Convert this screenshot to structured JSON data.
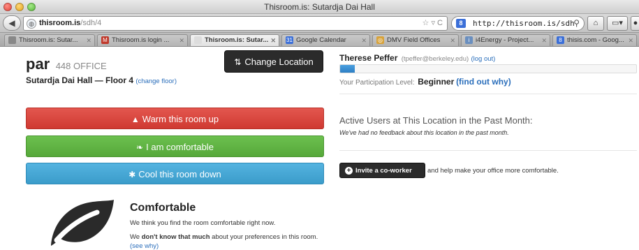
{
  "window": {
    "title": "Thisroom.is: Sutardja Dai Hall"
  },
  "nav": {
    "url_host": "thisroom.is",
    "url_path": "/sdh/4",
    "url_end_icons": "☆ ▿ C",
    "search_value": "http://thisroom.is/sdh",
    "search_engine_letter": "8"
  },
  "tabs": [
    {
      "label": "Thisroom.is: Sutar...",
      "active": false,
      "fav_color": "#888888",
      "fav": ""
    },
    {
      "label": "Thisroom.is login ...",
      "active": false,
      "fav_color": "#c0392b",
      "fav": "M"
    },
    {
      "label": "Thisroom.is: Sutar...",
      "active": true,
      "fav_color": "#dddddd",
      "fav": ""
    },
    {
      "label": "Google Calendar",
      "active": false,
      "fav_color": "#3b6fd8",
      "fav": "31"
    },
    {
      "label": "DMV Field Offices",
      "active": false,
      "fav_color": "#d8a33b",
      "fav": "◎"
    },
    {
      "label": "i4Energy - Project...",
      "active": false,
      "fav_color": "#6a8fbf",
      "fav": "i"
    },
    {
      "label": "thisis.com - Goog...",
      "active": false,
      "fav_color": "#3b6fd8",
      "fav": "8"
    }
  ],
  "room": {
    "code": "par",
    "office": "448 OFFICE",
    "floor": "Sutardja Dai Hall — Floor 4",
    "change_floor": "(change floor)",
    "change_location": "Change Location"
  },
  "votes": {
    "warm": "Warm this room up",
    "comfortable": "I am comfortable",
    "cool": "Cool this room down"
  },
  "status": {
    "heading": "Comfortable",
    "line1": "We think you find the room comfortable right now.",
    "line2_pre": "We ",
    "line2_bold": "don't know that much",
    "line2_post": " about your preferences in this room. ",
    "see_why": "(see why)"
  },
  "user": {
    "name": "Therese Peffer",
    "email": "(tpeffer@berkeley.edu)",
    "logout": "(log out)",
    "progress": 0.05,
    "participation_label": "Your Participation Level:",
    "level": "Beginner",
    "find_out": "(find out why)"
  },
  "activity": {
    "heading": "Active Users at This Location in the Past Month:",
    "sub": "We've had no feedback about this location in the past month."
  },
  "invite": {
    "button": "Invite a co-worker",
    "text": "and help make your office more comfortable."
  }
}
